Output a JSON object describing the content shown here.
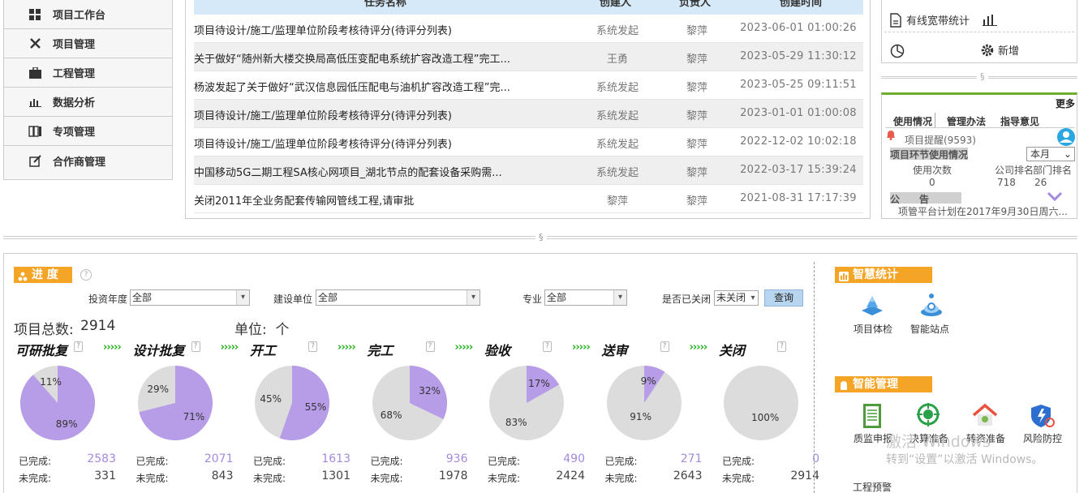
{
  "nav": {
    "items": [
      {
        "label": "项目工作台",
        "icon": "grid-icon"
      },
      {
        "label": "项目管理",
        "icon": "tools-icon"
      },
      {
        "label": "工程管理",
        "icon": "briefcase-icon"
      },
      {
        "label": "数据分析",
        "icon": "bar-chart-icon"
      },
      {
        "label": "专项管理",
        "icon": "files-icon"
      },
      {
        "label": "合作商管理",
        "icon": "edit-icon"
      }
    ]
  },
  "tasks": {
    "headers": {
      "name": "任务名称",
      "creator": "创建人",
      "owner": "负责人",
      "time": "创建时间"
    },
    "rows": [
      {
        "name": "项目待设计/施工/监理单位阶段考核待评分(待评分列表)",
        "creator": "系统发起",
        "owner": "黎萍",
        "time": "2023-06-01 01:00:26"
      },
      {
        "name": "关于做好“随州新大楼交换局高低压变配电系统扩容改造工程”完工...",
        "creator": "王勇",
        "owner": "黎萍",
        "time": "2023-05-29 11:30:12"
      },
      {
        "name": "杨波发起了关于做好“武汉信息园低压配电与油机扩容改造工程”完...",
        "creator": "系统发起",
        "owner": "黎萍",
        "time": "2023-05-25 09:11:51"
      },
      {
        "name": "项目待设计/施工/监理单位阶段考核待评分(待评分列表)",
        "creator": "系统发起",
        "owner": "黎萍",
        "time": "2023-01-01 01:00:08"
      },
      {
        "name": "项目待设计/施工/监理单位阶段考核待评分(待评分列表)",
        "creator": "系统发起",
        "owner": "黎萍",
        "time": "2022-12-02 10:02:18"
      },
      {
        "name": "中国移动5G二期工程SA核心网项目_湖北节点的配套设备采购需...",
        "creator": "系统发起",
        "owner": "黎萍",
        "time": "2022-03-17 15:39:24"
      },
      {
        "name": "关闭2011年全业务配套传输网管线工程,请审批",
        "creator": "黎萍",
        "owner": "黎萍",
        "time": "2021-08-31 17:17:39"
      }
    ]
  },
  "right_top": {
    "broadband_label": "有线宽带统计",
    "add_label": "新增"
  },
  "separator_mark": "§",
  "usage": {
    "more": "更多",
    "tabs": [
      "使用情况",
      "管理办法",
      "指导意见"
    ],
    "reminder": "项目提醒(9593)",
    "section_title": "项目环节使用情况",
    "period": "本月",
    "col_count_label": "使用次数",
    "col_company_label": "公司排名",
    "col_dept_label": "部门排名",
    "count": "0",
    "company_rank": "718",
    "dept_rank": "26",
    "notice_label": "公　　告",
    "notice_text": "项管平台计划在2017年9月30日周六..."
  },
  "progress": {
    "title": "进 度",
    "filters": {
      "year_label": "投资年度",
      "year_value": "全部",
      "unit_label": "建设单位",
      "unit_value": "全部",
      "major_label": "专业",
      "major_value": "全部",
      "closed_label": "是否已关闭",
      "closed_value": "未关闭",
      "query_button": "查询"
    },
    "total_label": "项目总数:",
    "total_value": "2914",
    "unit_text": "单位:  个",
    "done_label": "已完成:",
    "undone_label": "未完成:",
    "arrows": "›››››",
    "colors": {
      "done": "#b79ce8",
      "undone": "#dcdcdc",
      "accent": "#f5a526"
    },
    "stages": [
      {
        "name": "可研批复",
        "done": 2583,
        "undone": 331,
        "done_pct": "89%",
        "undone_pct": "11%"
      },
      {
        "name": "设计批复",
        "done": 2071,
        "undone": 843,
        "done_pct": "71%",
        "undone_pct": "29%"
      },
      {
        "name": "开工",
        "done": 1613,
        "undone": 1301,
        "done_pct": "55%",
        "undone_pct": "45%"
      },
      {
        "name": "完工",
        "done": 936,
        "undone": 1978,
        "done_pct": "32%",
        "undone_pct": "68%"
      },
      {
        "name": "验收",
        "done": 490,
        "undone": 2424,
        "done_pct": "17%",
        "undone_pct": "83%"
      },
      {
        "name": "送审",
        "done": 271,
        "undone": 2643,
        "done_pct": "9%",
        "undone_pct": "91%"
      },
      {
        "name": "关闭",
        "done": 0,
        "undone": 2914,
        "done_pct": "",
        "undone_pct": "100%"
      }
    ]
  },
  "smart_stats": {
    "title": "智慧统计",
    "items": [
      {
        "label": "项目体检"
      },
      {
        "label": "智能站点"
      }
    ]
  },
  "smart_mgmt": {
    "title": "智能管理",
    "items": [
      {
        "label": "质监申报"
      },
      {
        "label": "决算准备"
      },
      {
        "label": "转资准备"
      },
      {
        "label": "风险防控"
      }
    ],
    "early_warning": "工程预警"
  },
  "watermark": {
    "line1": "激活 Windows",
    "line2": "转到“设置”以激活 Windows。"
  }
}
